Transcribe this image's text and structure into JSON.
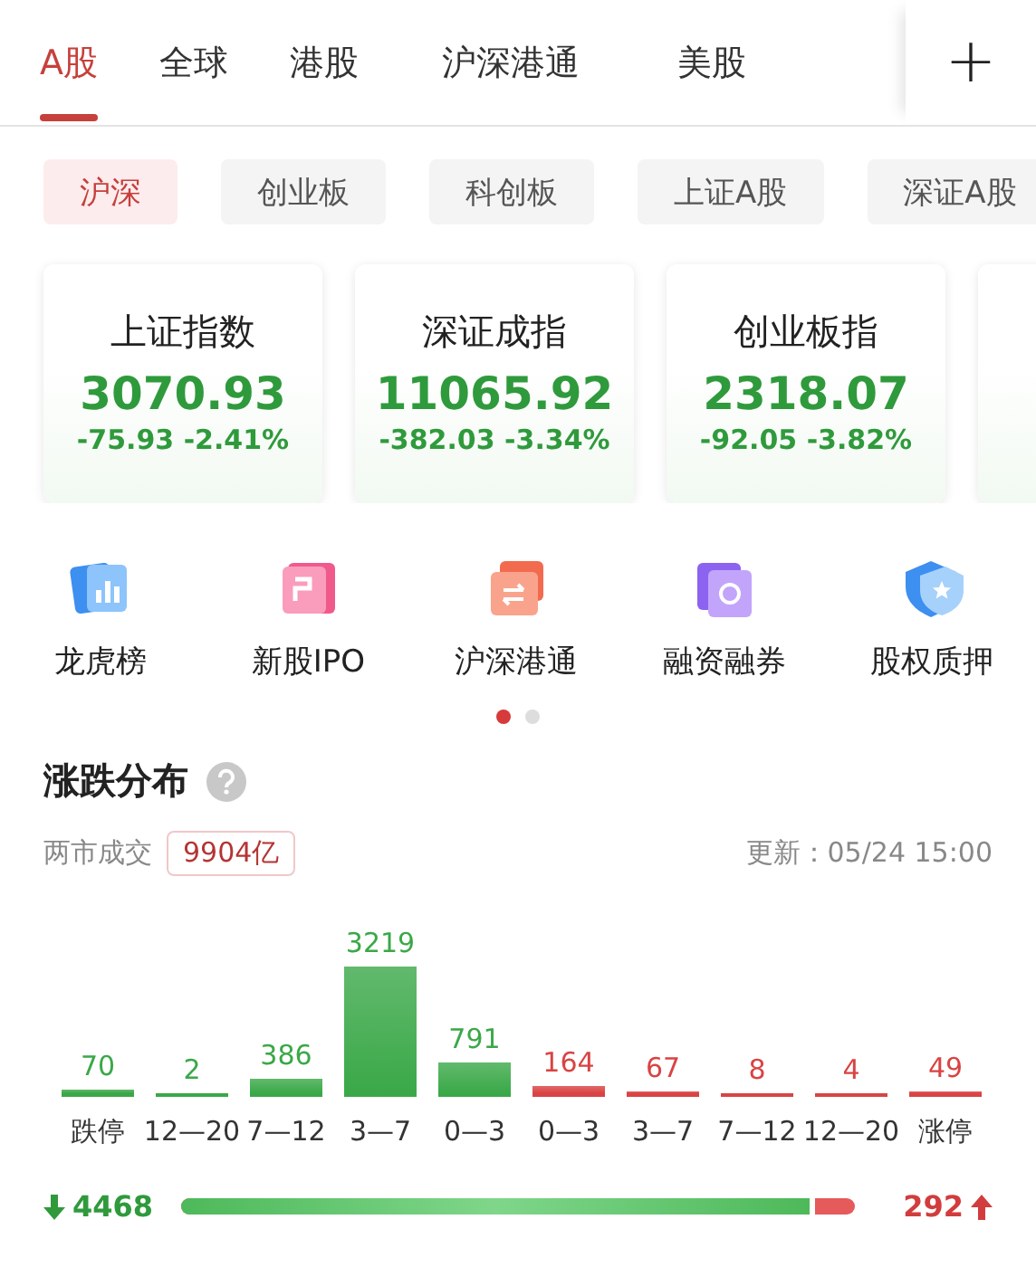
{
  "tabs": [
    {
      "label": "A股",
      "selected": true
    },
    {
      "label": "全球",
      "selected": false
    },
    {
      "label": "港股",
      "selected": false
    },
    {
      "label": "沪深港通",
      "selected": false
    },
    {
      "label": "美股",
      "selected": false
    }
  ],
  "add_button": {
    "label": "+"
  },
  "market_chips": [
    {
      "label": "沪深",
      "selected": true
    },
    {
      "label": "创业板",
      "selected": false
    },
    {
      "label": "科创板",
      "selected": false
    },
    {
      "label": "上证A股",
      "selected": false
    },
    {
      "label": "深证A股",
      "selected": false
    }
  ],
  "index_cards": [
    {
      "name": "上证指数",
      "value": "3070.93",
      "change": "-75.93",
      "percent": "-2.41%"
    },
    {
      "name": "深证成指",
      "value": "11065.92",
      "change": "-382.03",
      "percent": "-3.34%"
    },
    {
      "name": "创业板指",
      "value": "2318.07",
      "change": "-92.05",
      "percent": "-3.82%"
    }
  ],
  "shortcuts": [
    {
      "label": "龙虎榜"
    },
    {
      "label": "新股IPO"
    },
    {
      "label": "沪深港通"
    },
    {
      "label": "融资融券"
    },
    {
      "label": "股权质押"
    }
  ],
  "pager_dots": [
    {
      "selected": true
    },
    {
      "selected": false
    }
  ],
  "distribution": {
    "title": "涨跌分布",
    "turnover_label": "两市成交",
    "turnover": "9904亿",
    "updated": "更新：05/24 15:00",
    "chart_data": {
      "type": "bar",
      "categories": [
        "跌停",
        "12—20",
        "7—12",
        "3—7",
        "0—3",
        "0—3",
        "3—7",
        "7—12",
        "12—20",
        "涨停"
      ],
      "data_labels": true,
      "stacked": true,
      "series": [
        {
          "color": "#3aa848",
          "values": [
            70,
            2,
            386,
            3219,
            791,
            null,
            null,
            null,
            null,
            null
          ]
        },
        {
          "color": "#d94343",
          "values": [
            null,
            null,
            null,
            null,
            null,
            164,
            67,
            8,
            4,
            49
          ]
        }
      ]
    },
    "falling": "4468",
    "rising": "292",
    "falling_share": {
      "level": 0.94
    }
  }
}
